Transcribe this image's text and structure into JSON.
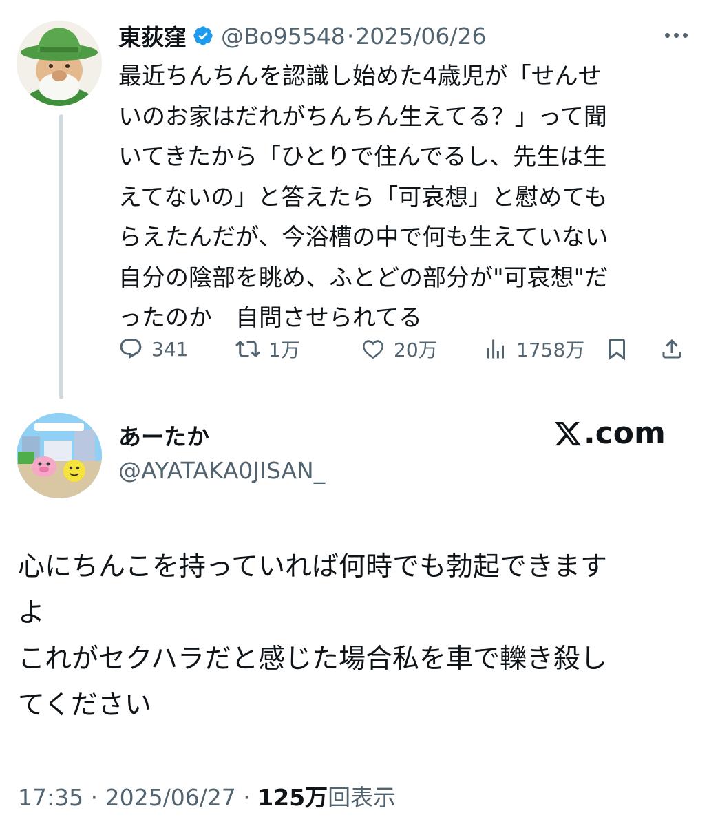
{
  "parent": {
    "name": "東荻窪",
    "handle": "@Bo95548",
    "separator": "·",
    "date": "2025/06/26",
    "text": "最近ちんちんを認識し始めた4歳児が「せんせ\nいのお家はだれがちんちん生えてる？」って聞\nいてきたから「ひとりで住んでるし、先生は生\nえてないの」と答えたら「可哀想」と慰めても\nらえたんだが、今浴槽の中で何も生えていない\n自分の陰部を眺め、ふとどの部分が\"可哀想\"だ\nったのか　自問させられてる",
    "icons": {
      "avatar": "green-hat-gnome-avatar",
      "verified": "verified-badge-icon",
      "more": "more-dots-icon"
    },
    "actions": {
      "replies": "341",
      "reposts": "1万",
      "likes": "20万",
      "views": "1758万"
    },
    "colors": {
      "verified": "#1d9bf0",
      "muted": "#536471",
      "text": "#0f1419",
      "thread_line": "#cfd9de"
    }
  },
  "reply": {
    "name": "あーたか",
    "handle": "@AYATAKA0JISAN_",
    "watermark": ".com",
    "text": "心にちんこを持っていれば何時でも勃起できます\nよ\nこれがセクハラだと感じた場合私を車で轢き殺し\nてください",
    "icons": {
      "avatar": "game-scene-avatar",
      "x_logo": "x-logo-icon"
    }
  },
  "footer": {
    "time": "17:35",
    "separator1": " · ",
    "date": "2025/06/27",
    "separator2": " · ",
    "views_count": "125万",
    "views_label": "回表示"
  }
}
